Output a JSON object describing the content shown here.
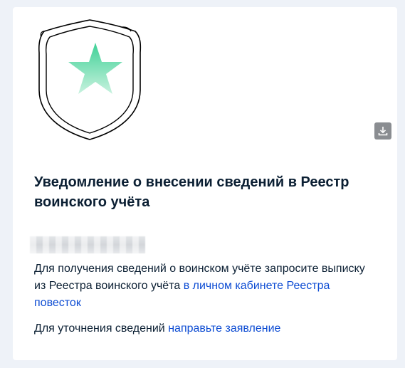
{
  "notice": {
    "title": "Уведомление о внесении сведений в Реестр воинского учёта",
    "download_icon": "download-icon",
    "shield_icon": "shield-star-icon",
    "redacted_field": "",
    "extract_text": "Для получения сведений о воинском учёте запросите выписку из Реестра воинского учёта",
    "extract_link": "в личном кабинете Реестра повесток",
    "clarify_text": "Для уточнения сведений",
    "clarify_link": "направьте заявление"
  },
  "colors": {
    "background": "#eef2f8",
    "card": "#ffffff",
    "text": "#0b1f33",
    "link": "#0d4cd3",
    "star": "#3ed196",
    "button": "#8a8d91"
  }
}
